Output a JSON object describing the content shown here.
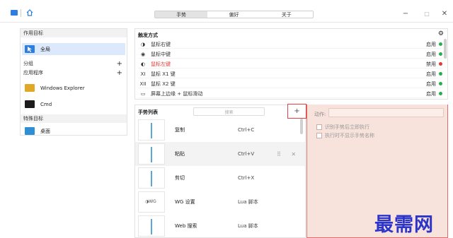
{
  "tabs": [
    {
      "label": "手势",
      "active": true
    },
    {
      "label": "偏好",
      "active": false
    },
    {
      "label": "关于",
      "active": false
    }
  ],
  "window_controls": {
    "minimize": "−",
    "maximize": "□",
    "close": "✕"
  },
  "left_panel": {
    "targets_header": "作用目标",
    "global_label": "全局",
    "groups_header": "分组",
    "apps_header": "应用程序",
    "apps": [
      {
        "label": "Windows Explorer",
        "icon": "folder-icon",
        "color": "#e0a826"
      },
      {
        "label": "Cmd",
        "icon": "terminal-icon",
        "color": "#1c1c1c"
      }
    ],
    "special_header": "特殊目标",
    "special": [
      {
        "label": "桌面",
        "icon": "desktop-icon",
        "color": "#2e8fd6"
      }
    ],
    "plus": "+"
  },
  "triggers": {
    "title": "触发方式",
    "gear": "⚙",
    "rows": [
      {
        "mark": "◑",
        "label": "鼠标右键",
        "status": "启用",
        "dot": "#22b14c",
        "red": false
      },
      {
        "mark": "◉",
        "label": "鼠标中键",
        "status": "启用",
        "dot": "#22b14c",
        "red": false
      },
      {
        "mark": "◐",
        "label": "鼠标左键",
        "status": "禁用",
        "dot": "#e53935",
        "red": true
      },
      {
        "mark": "XI",
        "label": "鼠标 X1 键",
        "status": "启用",
        "dot": "#22b14c",
        "red": false
      },
      {
        "mark": "XII",
        "label": "鼠标 X2 键",
        "status": "启用",
        "dot": "#22b14c",
        "red": false
      },
      {
        "mark": "▭",
        "label": "屏幕上边缘 + 鼠标滑动",
        "status": "启用",
        "dot": "#22b14c",
        "red": false
      }
    ]
  },
  "gestures": {
    "title": "手势列表",
    "search_placeholder": "搜索",
    "add": "+",
    "items": [
      {
        "name": "复制",
        "key": "Ctrl+C"
      },
      {
        "name": "粘贴",
        "key": "Ctrl+V"
      },
      {
        "name": "剪切",
        "key": "Ctrl+X"
      },
      {
        "name": "WG 设置",
        "key": "Lua 脚本",
        "thumb_text": "◑WG"
      },
      {
        "name": "Web 搜索",
        "key": "Lua 脚本"
      }
    ],
    "row_actions": "⠿ ✕"
  },
  "action_panel": {
    "action_label": "动作:",
    "options": [
      "识别手势后立即执行",
      "执行时不显示手势名称"
    ]
  },
  "watermark": "最需网"
}
